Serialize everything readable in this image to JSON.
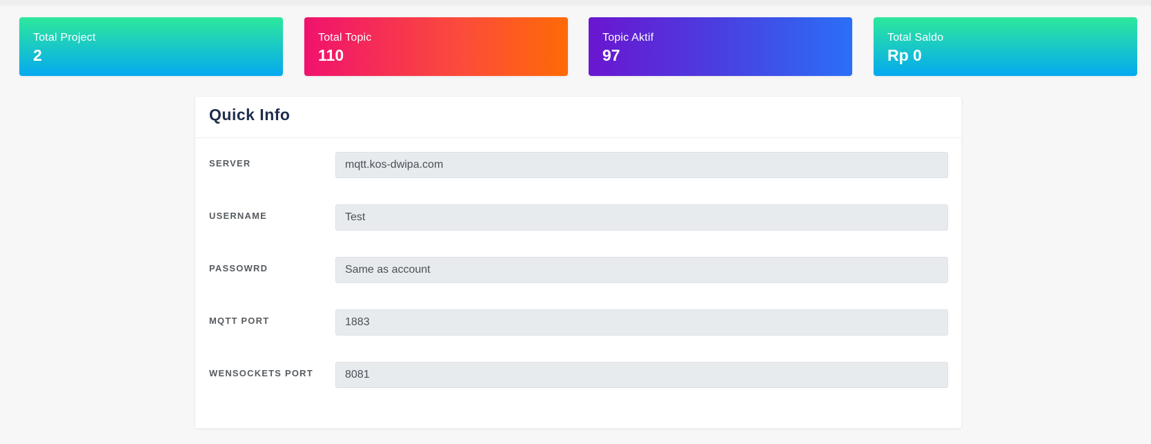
{
  "stats": [
    {
      "label": "Total Project",
      "value": "2"
    },
    {
      "label": "Total Topic",
      "value": "110"
    },
    {
      "label": "Topic Aktif",
      "value": "97"
    },
    {
      "label": "Total Saldo",
      "value": "Rp 0"
    }
  ],
  "quick_info": {
    "title": "Quick Info",
    "fields": [
      {
        "label": "SERVER",
        "value": "mqtt.kos-dwipa.com"
      },
      {
        "label": "USERNAME",
        "value": "Test"
      },
      {
        "label": "PASSOWRD",
        "value": "Same as account"
      },
      {
        "label": "MQTT PORT",
        "value": "1883"
      },
      {
        "label": "WENSOCKETS PORT",
        "value": "8081"
      }
    ]
  },
  "colors": {
    "page_background": "#f7f7f7",
    "title": "#1f2d4b",
    "input_background": "#e8ebee"
  }
}
